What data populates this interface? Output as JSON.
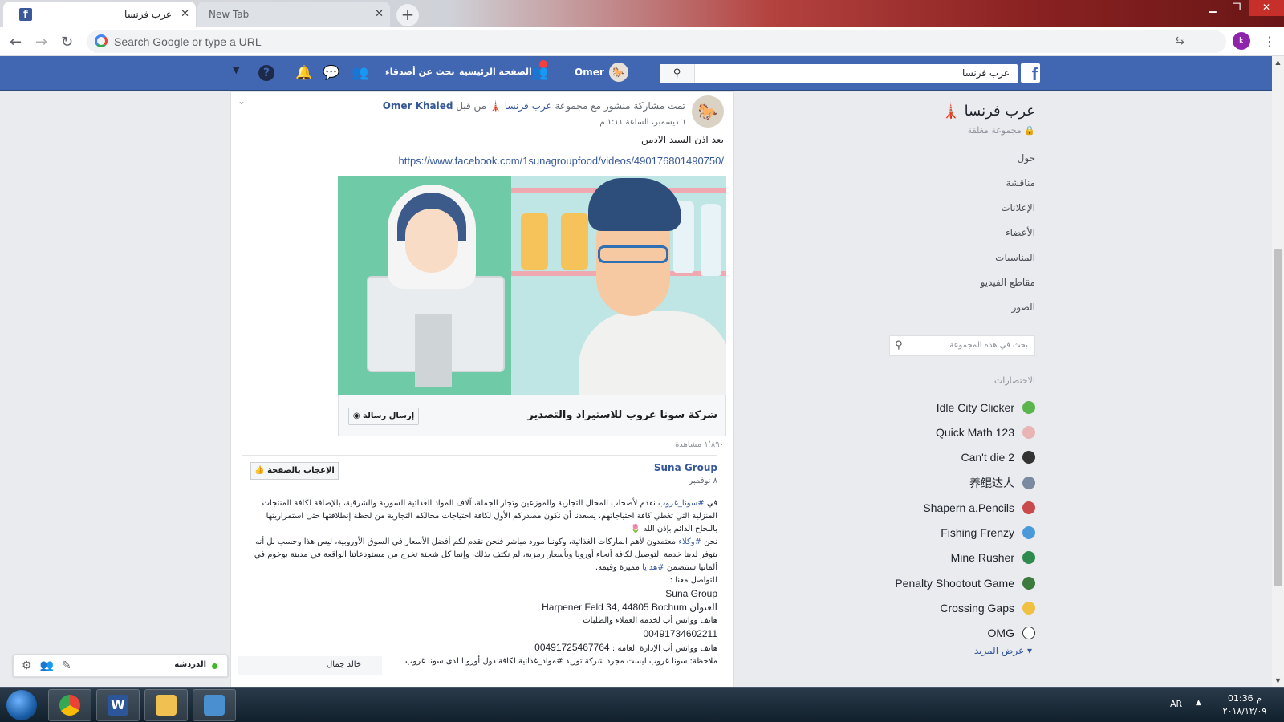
{
  "browser": {
    "tabs": [
      {
        "title": "عرب فرنسا",
        "active": true,
        "close": "✕"
      },
      {
        "title": "New Tab",
        "active": false,
        "close": "✕"
      }
    ],
    "new_tab": "+",
    "omnibox_placeholder": "Search Google or type a URL",
    "profile_initial": "k"
  },
  "fb": {
    "logo": "f",
    "search_value": "عرب فرنسا",
    "profile_name": "Omer",
    "nav": {
      "home": "الصفحة الرئيسية",
      "find_friends": "بحث عن أصدقاء"
    }
  },
  "post": {
    "shared_text": "تمت مشاركة منشور مع مجموعة",
    "group_link": "عرب فرنسا 🗼",
    "by": "من قبل",
    "author": "Omer Khaled",
    "timestamp": "٦ ديسمبر، الساعة ١:١١ م",
    "text": "بعد اذن السيد الادمن",
    "link": "https://www.facebook.com/1sunagroupfood/videos/490176801490750/",
    "video_title": "شركة سونا غروب للاستيراد والتصدير",
    "send_message": "إرسال رسالة",
    "views": "١٬٨٩٠ مشاهدة",
    "shared": {
      "page_name": "Suna Group",
      "date": "٨ نوفمبر",
      "like_page": "الإعجاب بالصفحة",
      "p1_pre": "في",
      "p1_tag": "#سونا_غروب",
      "p1_rest": "نقدم لأصحاب المحال التجارية والموزعين وتجار الجملة، آلاف المواد الغذائية السورية والشرقية، بالإضافة لكافة المنتجات المنزلية التي تغطي كافة احتياجاتهم، يسعدنا أن نكون مصدركم الأول لكافة احتياجات محالكم التجارية من لحظة إنطلاقتها حتى استمراريتها بالنجاح الدائم بإذن الله 🌷",
      "p2_pre": "نحن",
      "p2_tag": "#وكلاء",
      "p2_rest": "معتمدون لأهم الماركات الغذائية، وكوننا مورد مباشر فنحن نقدم لكم أفضل الأسعار في السوق الأوروبية، ليس هذا وحسب بل أنه يتوفر لدينا خدمة التوصيل لكافة أنحاء أوروبا وبأسعار رمزية، لم نكتف بذلك، وإنما كل شحنة تخرج من مستودعاتنا الواقعة في مدينة بوخوم في ألمانيا ستتضمن",
      "p2_tag2": "#هدايا",
      "p2_end": "مميزة وقيمة.",
      "contact_label": "للتواصل معنا :",
      "company": "Suna Group",
      "address_label": "العنوان",
      "address": "Harpener Feld 34, 44805 Bochum",
      "wa_orders_label": "هاتف وواتس أب لخدمة العملاء والطلبات :",
      "wa_orders": "00491734602211",
      "wa_admin_label": "هاتف وواتس أب الإدارة العامة :",
      "wa_admin": "00491725467764",
      "cutoff": "ملاحظة: سونا غروب ليست مجرد شركة توريد #مواد_غذائية لكافة دول أوروبا لدى سونا غروب"
    }
  },
  "sidebar": {
    "group_title": "عرب فرنسا 🗼",
    "group_type": "🔒 مجموعة مغلقة",
    "nav": [
      "حول",
      "مناقشة",
      "الإعلانات",
      "الأعضاء",
      "المناسبات",
      "مقاطع الفيديو",
      "الصور"
    ],
    "search_placeholder": "بحث في هذه المجموعة",
    "shortcuts_label": "الاختصارات",
    "shortcuts": [
      {
        "name": "Idle City Clicker",
        "color": "#5ab54b"
      },
      {
        "name": "Quick Math 123",
        "color": "#e8b4b4"
      },
      {
        "name": "Can't die 2",
        "color": "#333333"
      },
      {
        "name": "养鲲达人",
        "color": "#7a8aa0"
      },
      {
        "name": "Shapern a.Pencils",
        "color": "#c94a4a"
      },
      {
        "name": "Fishing Frenzy",
        "color": "#4a9ad9"
      },
      {
        "name": "Mine Rusher",
        "color": "#2f8a4f"
      },
      {
        "name": "Penalty Shootout Game",
        "color": "#3d7a3d"
      },
      {
        "name": "Crossing Gaps",
        "color": "#f0c040"
      },
      {
        "name": "OMG",
        "color": "#ffffff"
      }
    ],
    "show_more": "عرض المزيد"
  },
  "chat": {
    "label": "الدردشة",
    "contact": "خالد جمال"
  },
  "taskbar": {
    "lang": "AR",
    "time": "01:36 م",
    "date": "٢٠١٨/١٢/٠٩"
  }
}
